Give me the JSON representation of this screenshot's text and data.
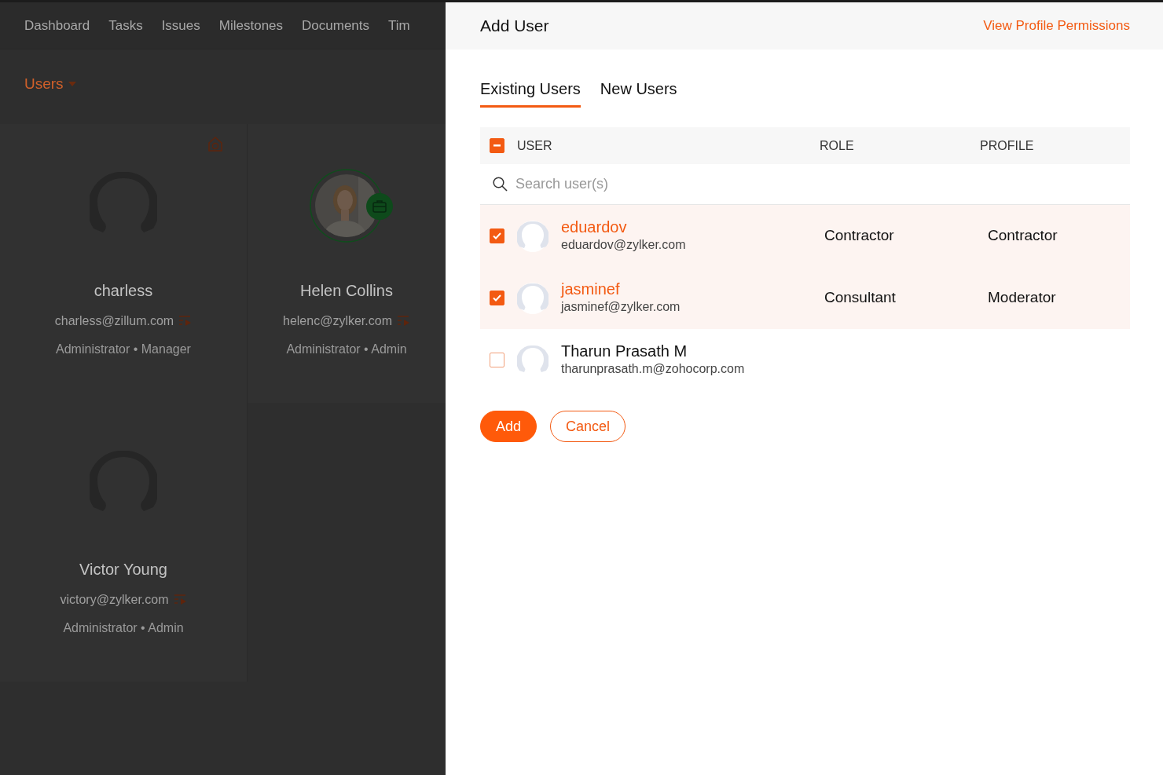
{
  "nav": {
    "items": [
      "Dashboard",
      "Tasks",
      "Issues",
      "Milestones",
      "Documents",
      "Tim"
    ]
  },
  "view_menu": {
    "label": "Users"
  },
  "users": [
    {
      "name": "charless",
      "email": "charless@zillum.com",
      "role": "Administrator • Manager",
      "kind": "silhouette",
      "corner_icon": true
    },
    {
      "name": "Helen Collins",
      "email": "helenc@zylker.com",
      "role": "Administrator • Admin",
      "corner_icon": false
    },
    {
      "name": "Victor Young",
      "email": "victory@zylker.com",
      "role": "Administrator • Admin",
      "kind": "silhouette",
      "corner_icon": false
    }
  ],
  "panel": {
    "title": "Add User",
    "link": "View Profile Permissions",
    "tabs": [
      {
        "label": "Existing Users",
        "selected": true
      },
      {
        "label": "New Users",
        "selected": false
      }
    ],
    "select_all": {
      "indeterminate": true
    },
    "columns": [
      "USER",
      "ROLE",
      "PROFILE"
    ],
    "search": {
      "placeholder": "Search user(s)"
    },
    "rows": [
      {
        "name": "eduardov",
        "email": "eduardov@zylker.com",
        "role": "Contractor",
        "profile": "Contractor",
        "checked": true
      },
      {
        "name": "jasminef",
        "email": "jasminef@zylker.com",
        "role": "Consultant",
        "profile": "Moderator",
        "checked": true
      },
      {
        "name": "Tharun Prasath M",
        "email": "tharunprasath.m@zohocorp.com",
        "checked": false
      }
    ],
    "buttons": [
      {
        "label": "Add",
        "kind": "primary"
      },
      {
        "label": "Cancel",
        "kind": "outline"
      }
    ]
  }
}
